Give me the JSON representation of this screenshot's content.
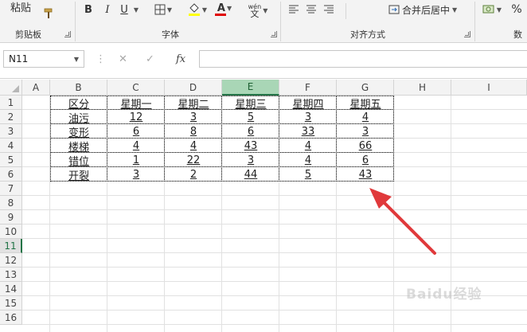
{
  "ribbon": {
    "clipboard": {
      "paste_label": "粘贴",
      "group_label": "剪贴板"
    },
    "font": {
      "bold": "B",
      "italic": "I",
      "underline": "U",
      "font_color_glyph": "A",
      "phonetic_glyph": "wén",
      "phonetic_char": "文",
      "group_label": "字体"
    },
    "alignment": {
      "merge_label": "合并后居中",
      "group_label": "对齐方式"
    },
    "number": {
      "percent": "%",
      "group_label": "数"
    }
  },
  "formula_bar": {
    "name_box": "N11",
    "fx_label": "fx",
    "formula_value": ""
  },
  "sheet": {
    "columns": [
      "A",
      "B",
      "C",
      "D",
      "E",
      "F",
      "G",
      "H",
      "I"
    ],
    "selected_column": "E",
    "rows": [
      "1",
      "2",
      "3",
      "4",
      "5",
      "6",
      "7",
      "8",
      "9",
      "10",
      "11",
      "12",
      "13",
      "14",
      "15",
      "16"
    ],
    "selected_row": "11",
    "table": {
      "header": [
        "区分",
        "星期一",
        "星期二",
        "星期三",
        "星期四",
        "星期五"
      ],
      "body": [
        [
          "油污",
          "12",
          "3",
          "5",
          "3",
          "4"
        ],
        [
          "变形",
          "6",
          "8",
          "6",
          "33",
          "3"
        ],
        [
          "楼梯",
          "4",
          "4",
          "43",
          "4",
          "66"
        ],
        [
          "错位",
          "1",
          "22",
          "3",
          "4",
          "6"
        ],
        [
          "开裂",
          "3",
          "2",
          "44",
          "5",
          "43"
        ]
      ]
    }
  },
  "watermark": "Baidu经验",
  "colors": {
    "accent_green": "#217346",
    "selected_header": "#a9d6b6",
    "arrow": "#e0393b",
    "font_color_bar": "#e00000",
    "fill_color_bar": "#ffff00"
  }
}
